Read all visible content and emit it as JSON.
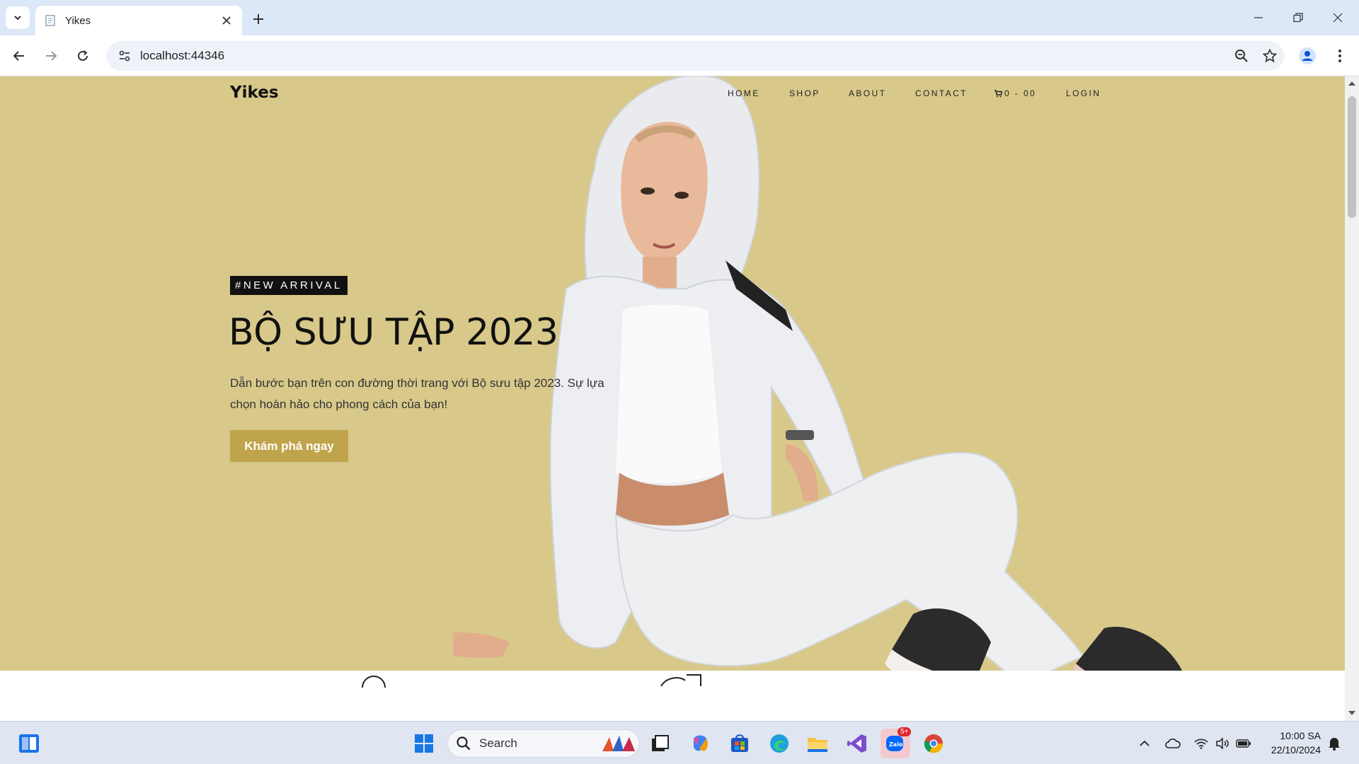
{
  "browser": {
    "tab_title": "Yikes",
    "url": "localhost:44346"
  },
  "site": {
    "brand": "Yikes",
    "nav": {
      "home": "HOME",
      "shop": "SHOP",
      "about": "ABOUT",
      "contact": "CONTACT",
      "cart": "0 - 00",
      "login": "LOGIN"
    },
    "hero": {
      "badge": "#NEW ARRIVAL",
      "headline": "BỘ SƯU TẬP 2023",
      "description": "Dẫn bước bạn trên con đường thời trang với Bộ sưu tập 2023. Sự lựa chọn hoàn hảo cho phong cách của bạn!",
      "cta": "Khám phá ngay",
      "background_color": "#d8c98a",
      "cta_color": "#c0a44b"
    }
  },
  "taskbar": {
    "search_label": "Search",
    "zalo_badge": "5+",
    "time": "10:00 SA",
    "date": "22/10/2024"
  }
}
